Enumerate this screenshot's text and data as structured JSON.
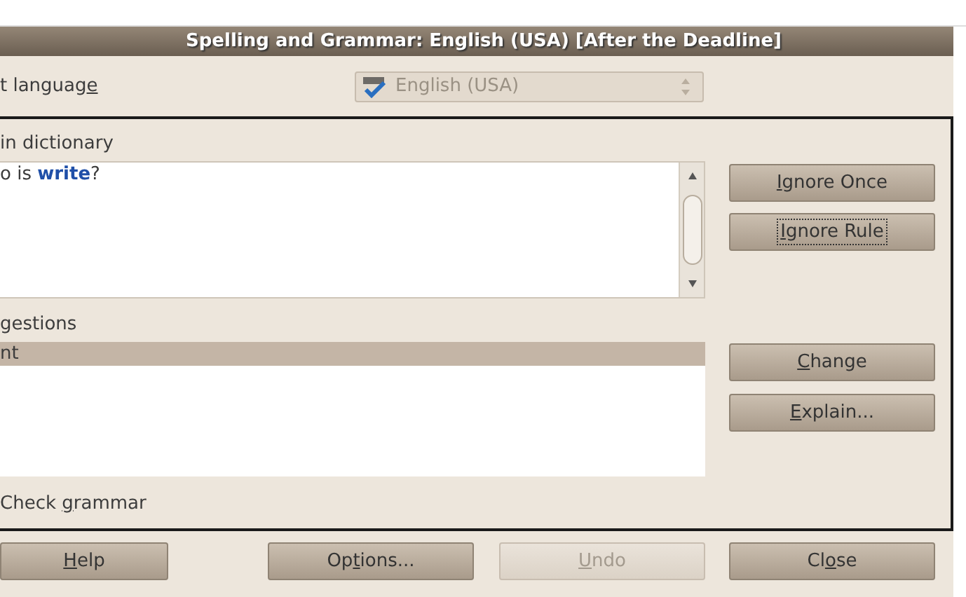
{
  "window": {
    "title": "Spelling and Grammar: English (USA) [After the Deadline]"
  },
  "language": {
    "label": {
      "pre": "t languag",
      "key": "e"
    },
    "value": "English (USA)",
    "disabled": true
  },
  "not_in_dictionary": {
    "label": "in dictionary",
    "text": "o is **write**?"
  },
  "side_buttons": [
    {
      "key": "I",
      "post": "gnore Once",
      "focused": false
    },
    {
      "key": "I",
      "post": "gnore Rule",
      "focused": true
    },
    {
      "key": "C",
      "post": "hange",
      "focused": false
    },
    {
      "key": "E",
      "post": "xplain...",
      "focused": false
    }
  ],
  "suggestions": {
    "label": "gestions",
    "items": [
      {
        "text": "nt",
        "selected": true
      }
    ]
  },
  "check_grammar": {
    "pre": "Check ",
    "key": "g",
    "post": "rammar"
  },
  "bottom_buttons": [
    {
      "key": "H",
      "post": "elp",
      "disabled": false
    },
    {
      "pre": "Op",
      "key": "t",
      "post": "ions...",
      "disabled": false
    },
    {
      "key": "U",
      "post": "ndo",
      "disabled": true
    },
    {
      "pre": "Cl",
      "key": "o",
      "post": "se",
      "disabled": false
    }
  ]
}
